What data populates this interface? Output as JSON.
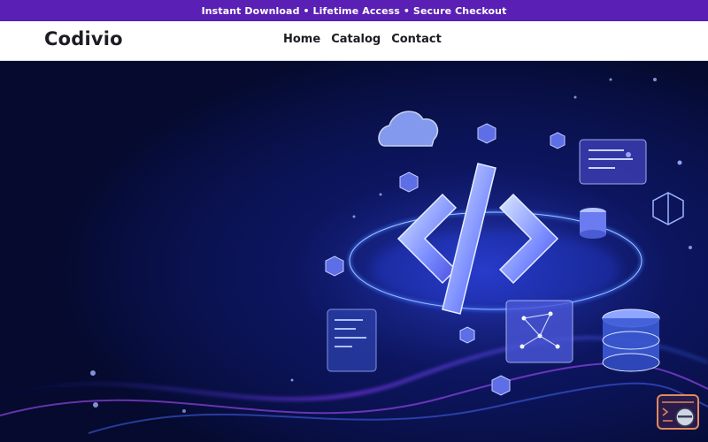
{
  "announcement": {
    "text": "Instant Download • Lifetime Access • Secure Checkout"
  },
  "header": {
    "logo": "Codivio",
    "nav": [
      {
        "label": "Home"
      },
      {
        "label": "Catalog"
      },
      {
        "label": "Contact"
      }
    ]
  },
  "hero": {
    "image_icon": "code-brackets-illustration",
    "colors": {
      "background": "#050a2e",
      "glow": "#3a5bff",
      "accent": "#a64dff"
    }
  },
  "chat_widget": {
    "icon": "chat-support-icon"
  },
  "colors": {
    "topbar": "#5a1fb4",
    "header_bg": "#ffffff",
    "text": "#1c1c24"
  }
}
